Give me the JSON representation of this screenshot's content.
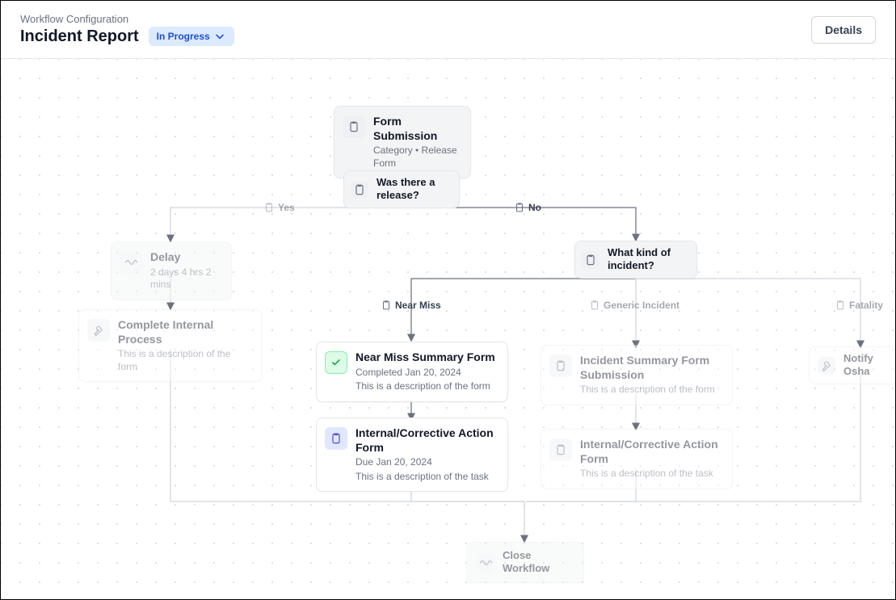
{
  "header": {
    "breadcrumb": "Workflow Configuration",
    "title": "Incident Report",
    "status": "In Progress",
    "details_label": "Details"
  },
  "nodes": {
    "form_submission": {
      "title": "Form Submission",
      "sub": "Category • Release Form"
    },
    "release_question": {
      "title": "Was there a release?"
    },
    "delay": {
      "title": "Delay",
      "sub": "2 days 4 hrs 2 mins"
    },
    "complete_internal": {
      "title": "Complete Internal Process",
      "desc": "This is a description of the form"
    },
    "incident_kind": {
      "title": "What kind of incident?"
    },
    "near_miss_form": {
      "title": "Near Miss Summary Form",
      "sub": "Completed Jan 20, 2024",
      "desc": "This is a description of the form"
    },
    "corrective1": {
      "title": "Internal/Corrective Action Form",
      "sub": "Due Jan 20, 2024",
      "desc": "This is a description of the task"
    },
    "incident_summary": {
      "title": "Incident Summary Form Submission",
      "desc": "This is a description of the form"
    },
    "corrective2": {
      "title": "Internal/Corrective Action Form",
      "desc": "This is a description of the task"
    },
    "notify_osha": {
      "title": "Notify Osha"
    },
    "close_workflow": {
      "title": "Close Workflow"
    }
  },
  "branches": {
    "yes": "Yes",
    "no": "No",
    "near_miss": "Near Miss",
    "generic": "Generic Incident",
    "fatality": "Fatality"
  }
}
